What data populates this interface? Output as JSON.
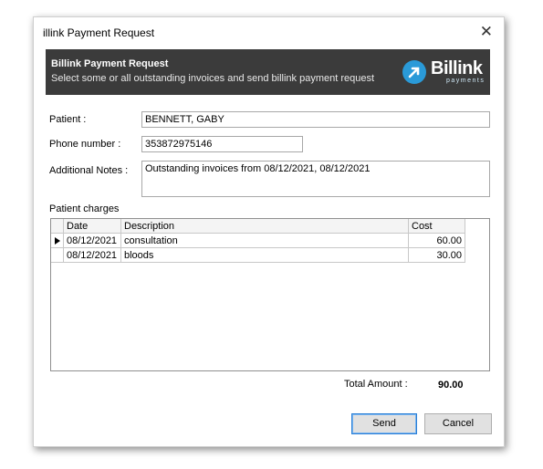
{
  "window": {
    "title": "illink Payment Request",
    "close_glyph": "✕"
  },
  "header": {
    "title": "Billink Payment Request",
    "subtitle": "Select some or all outstanding invoices and send billink payment request",
    "logo": {
      "name": "Billink",
      "tagline": "payments",
      "accent": "#2a9ad8",
      "icon": "arrow-up-right-icon"
    }
  },
  "form": {
    "patient_label": "Patient :",
    "patient_value": "BENNETT, GABY",
    "phone_label": "Phone number :",
    "phone_value": "353872975146",
    "notes_label": "Additional Notes :",
    "notes_value": "Outstanding invoices from 08/12/2021, 08/12/2021"
  },
  "charges": {
    "section_label": "Patient charges",
    "columns": [
      "Date",
      "Description",
      "Cost"
    ],
    "rows": [
      {
        "date": "08/12/2021",
        "description": "consultation",
        "cost": "60.00",
        "selected": true
      },
      {
        "date": "08/12/2021",
        "description": "bloods",
        "cost": "30.00",
        "selected": false
      }
    ]
  },
  "totals": {
    "label": "Total Amount :",
    "value": "90.00"
  },
  "buttons": {
    "send": "Send",
    "cancel": "Cancel"
  }
}
